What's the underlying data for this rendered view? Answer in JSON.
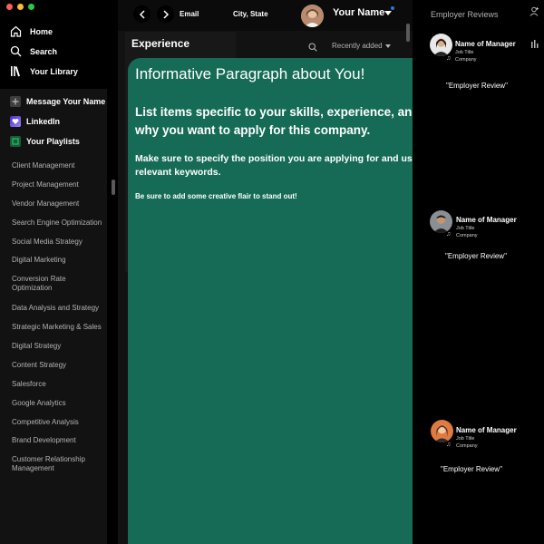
{
  "window": {
    "traffic_colors": [
      "#ff5f57",
      "#febc2e",
      "#28c840"
    ]
  },
  "nav": {
    "items": [
      {
        "label": "Home",
        "icon": "home-icon"
      },
      {
        "label": "Search",
        "icon": "search-icon"
      },
      {
        "label": "Your Library",
        "icon": "library-icon"
      }
    ]
  },
  "library": {
    "items": [
      {
        "label": "Message Your Name",
        "icon": "plus-icon"
      },
      {
        "label": "LinkedIn",
        "icon": "heart-icon"
      },
      {
        "label": "Your Playlists",
        "icon": "playlist-icon"
      }
    ]
  },
  "skills": [
    "Client Management",
    "Project Management",
    "Vendor Management",
    "Search Engine Optimization",
    "Social Media Strategy",
    "Digital Marketing",
    "Conversion Rate Optimization",
    "Data Analysis and Strategy",
    "Strategic Marketing & Sales",
    "Digital Strategy",
    "Content Strategy",
    "Salesforce",
    "Google Analytics",
    "Competitive Analysis",
    "Brand Development",
    "Customer Relationship Management"
  ],
  "topbar": {
    "email": "Email",
    "location": "City, State",
    "user_name": "Your Name"
  },
  "experience": {
    "title": "Experience",
    "sort_label": "Recently added"
  },
  "card": {
    "heading": "Informative Paragraph about You!",
    "list_text": "List items specific to your skills, experience, and why you want to apply for this company.",
    "position_text": "Make sure to specify the position you are applying for and use relevant keywords.",
    "flair_text": "Be sure to add some creative flair to stand out!",
    "color": "#156b56"
  },
  "reviews": {
    "title": "Employer Reviews",
    "items": [
      {
        "name": "Name of Manager",
        "job_title": "Job Title",
        "company": "Company",
        "quote": "\"Employer Review\""
      },
      {
        "name": "Name of Manager",
        "job_title": "Job Title",
        "company": "Company",
        "quote": "\"Employer Review\""
      },
      {
        "name": "Name of Manager",
        "job_title": "Job Title",
        "company": "Company",
        "quote": "\"Employer Review\""
      }
    ]
  }
}
